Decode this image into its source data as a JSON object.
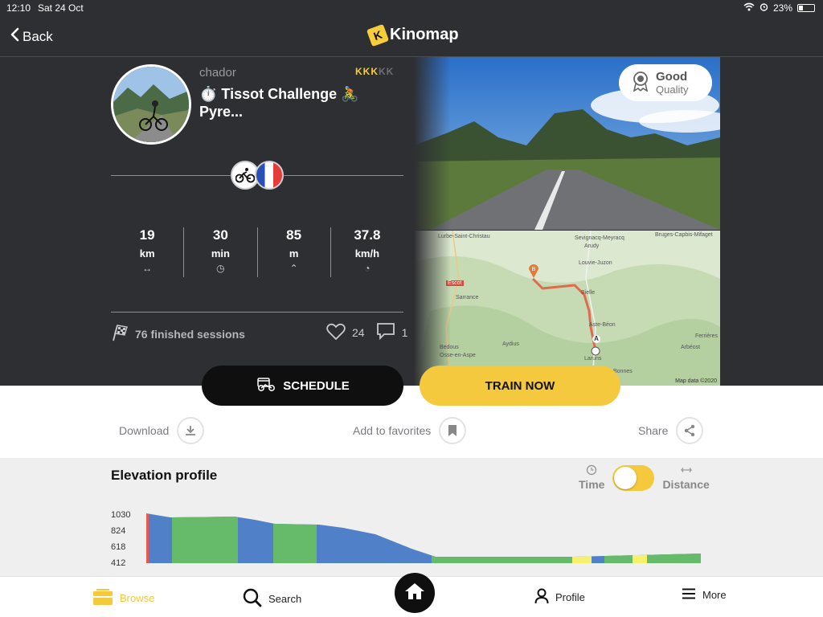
{
  "status_bar": {
    "time": "12:10",
    "date": "Sat 24 Oct",
    "battery": "23%"
  },
  "nav": {
    "back_label": "Back",
    "app_name": "Kinomap"
  },
  "video": {
    "author": "chador",
    "title": "⏱️ Tissot Challenge 🚴 Pyre...",
    "rating_glyphs": "KKKKK",
    "rating_active": 3,
    "quality_label": "Good",
    "quality_sub": "Quality",
    "sessions": "76 finished sessions",
    "likes": "24",
    "comments": "1"
  },
  "stats": [
    {
      "value": "19",
      "unit": "km",
      "icon": "↔"
    },
    {
      "value": "30",
      "unit": "min",
      "icon": "◷"
    },
    {
      "value": "85",
      "unit": "m",
      "icon": "⌃"
    },
    {
      "value": "37.8",
      "unit": "km/h",
      "icon": "◔"
    }
  ],
  "map": {
    "labels": [
      "Lurbe-Saint-Christau",
      "Sevignacq-Meyracq",
      "Bruges-Capbis-Mifaget",
      "Arudy",
      "Louvie-Juzon",
      "Sarrance",
      "Bielle",
      "Aste-Béon",
      "Aydius",
      "Bedous",
      "Osse-en-Aspe",
      "Laruns",
      "Ferrières",
      "Arbéost",
      "Bonnes",
      "Escot"
    ],
    "attribution": "Map data ©2020",
    "start_marker": "A",
    "end_marker": "B"
  },
  "buttons": {
    "schedule": "SCHEDULE",
    "train": "TRAIN NOW"
  },
  "actions": {
    "download": "Download",
    "favorites": "Add to favorites",
    "share": "Share"
  },
  "elevation": {
    "title": "Elevation profile",
    "toggle_left": "Time",
    "toggle_right": "Distance",
    "toggle_state": "Time",
    "ticks": [
      "1030",
      "824",
      "618",
      "412"
    ]
  },
  "tabs": {
    "browse": "Browse",
    "search": "Search",
    "profile": "Profile",
    "more": "More"
  },
  "colors": {
    "accent": "#f4c93d",
    "dark": "#2e2f32",
    "elev_blue": "#4f80c8",
    "elev_green": "#66bb6a",
    "elev_yellow": "#f6f06a"
  }
}
